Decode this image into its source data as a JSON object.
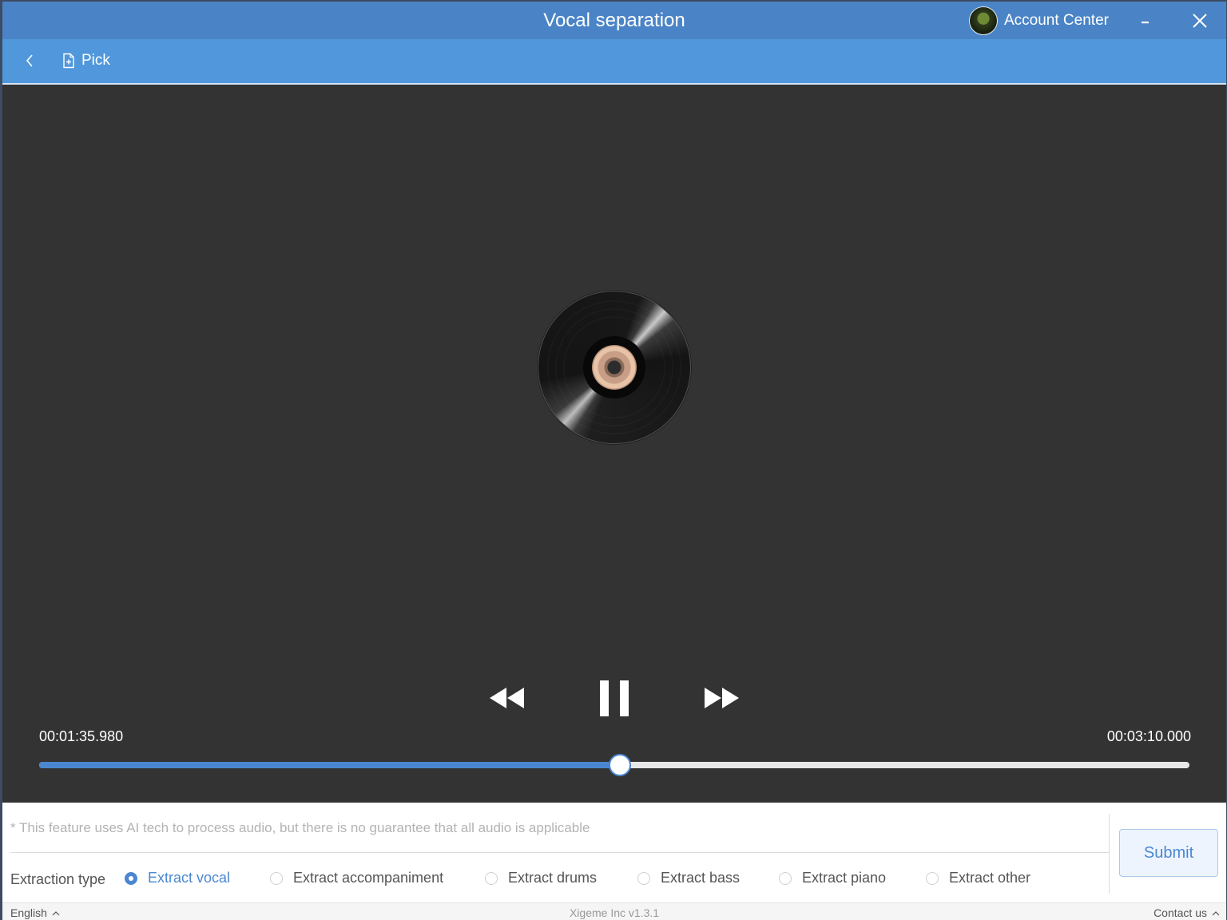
{
  "window": {
    "title": "Vocal separation",
    "account_label": "Account Center"
  },
  "toolbar": {
    "pick_label": "Pick"
  },
  "player": {
    "current_time": "00:01:35.980",
    "total_time": "00:03:10.000",
    "progress_fraction": 0.505
  },
  "panel": {
    "notice": "* This feature uses AI tech to process audio, but there is no guarantee that all audio is applicable",
    "extraction_type_label": "Extraction type",
    "options": [
      {
        "label": "Extract vocal",
        "selected": true
      },
      {
        "label": "Extract accompaniment",
        "selected": false
      },
      {
        "label": "Extract drums",
        "selected": false
      },
      {
        "label": "Extract bass",
        "selected": false
      },
      {
        "label": "Extract piano",
        "selected": false
      },
      {
        "label": "Extract other",
        "selected": false
      }
    ],
    "submit_label": "Submit"
  },
  "statusbar": {
    "language": "English",
    "version": "Xigeme Inc v1.3.1",
    "contact": "Contact us"
  },
  "colors": {
    "titlebar": "#4a84c6",
    "toolbar": "#5097db",
    "player_bg": "#333333",
    "accent": "#4b87d1"
  },
  "icons": {
    "back": "chevron-left-icon",
    "pick": "file-add-icon",
    "minimize": "minimize-icon",
    "close": "close-icon",
    "rewind": "rewind-icon",
    "pause": "pause-icon",
    "forward": "fast-forward-icon"
  }
}
